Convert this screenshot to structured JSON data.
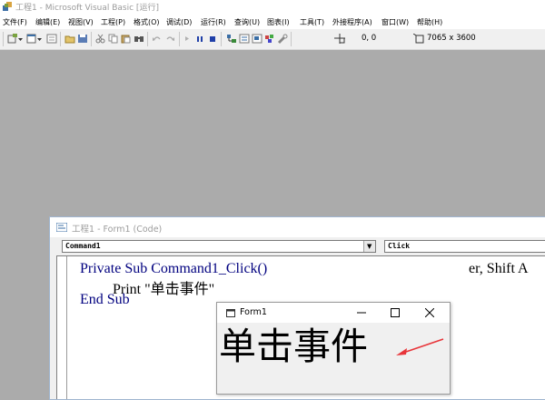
{
  "window": {
    "title": "工程1 - Microsoft Visual Basic [运行]"
  },
  "menubar": {
    "items": [
      {
        "label": "文件(F)"
      },
      {
        "label": "编辑(E)"
      },
      {
        "label": "视图(V)"
      },
      {
        "label": "工程(P)"
      },
      {
        "label": "格式(O)"
      },
      {
        "label": "调试(D)"
      },
      {
        "label": "运行(R)"
      },
      {
        "label": "查询(U)"
      },
      {
        "label": "图表(I)"
      },
      {
        "label": "工具(T)"
      },
      {
        "label": "外接程序(A)"
      },
      {
        "label": "窗口(W)"
      },
      {
        "label": "帮助(H)"
      }
    ]
  },
  "toolbar": {
    "position": "0, 0",
    "size": "7065 x 3600"
  },
  "code_window": {
    "title": "工程1 - Form1 (Code)",
    "object_combo": "Command1",
    "procedure_combo": "Click",
    "lines": {
      "line1": "Private Sub Command1_Click()",
      "line1_right": "er, Shift A",
      "line2": "Print \"单击事件\"",
      "line3": "End Sub"
    }
  },
  "form1": {
    "title": "Form1",
    "output": "单击事件",
    "arrow_color": "#e8353a"
  }
}
